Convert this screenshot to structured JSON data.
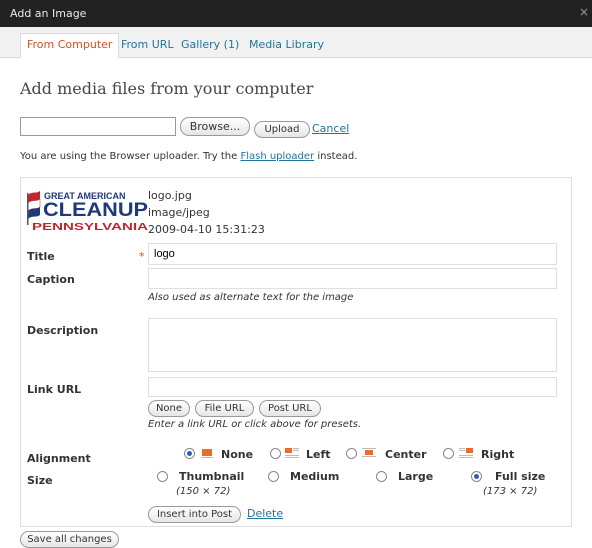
{
  "window": {
    "title": "Add an Image",
    "close_glyph": "×"
  },
  "tabs": [
    {
      "label": "From Computer",
      "active": true
    },
    {
      "label": "From URL",
      "active": false
    },
    {
      "label": "Gallery (1)",
      "active": false
    },
    {
      "label": "Media Library",
      "active": false
    }
  ],
  "heading": "Add media files from your computer",
  "upload": {
    "file_value": "",
    "browse_label": "Browse...",
    "upload_label": "Upload",
    "cancel_label": "Cancel",
    "note_prefix": "You are using the Browser uploader. Try the ",
    "note_link": "Flash uploader",
    "note_suffix": " instead."
  },
  "logo": {
    "line1": "GREAT AMERICAN",
    "line2": "CLEANUP",
    "line3": "PENNSYLVANIA"
  },
  "file": {
    "name": "logo.jpg",
    "type": "image/jpeg",
    "date": "2009-04-10 15:31:23"
  },
  "form": {
    "title_label": "Title",
    "required_mark": "*",
    "title_value": "logo",
    "caption_label": "Caption",
    "caption_value": "",
    "caption_help": "Also used as alternate text for the image",
    "description_label": "Description",
    "description_value": "",
    "link_label": "Link URL",
    "link_value": "",
    "link_buttons": [
      "None",
      "File URL",
      "Post URL"
    ],
    "link_help": "Enter a link URL or click above for presets.",
    "alignment_label": "Alignment",
    "alignment_options": [
      {
        "label": "None",
        "selected": true
      },
      {
        "label": "Left",
        "selected": false
      },
      {
        "label": "Center",
        "selected": false
      },
      {
        "label": "Right",
        "selected": false
      }
    ],
    "size_label": "Size",
    "size_options": [
      {
        "label": "Thumbnail",
        "dims": "(150 × 72)",
        "selected": false
      },
      {
        "label": "Medium",
        "dims": "",
        "selected": false
      },
      {
        "label": "Large",
        "dims": "",
        "selected": false
      },
      {
        "label": "Full size",
        "dims": "(173 × 72)",
        "selected": true
      }
    ],
    "insert_label": "Insert into Post",
    "delete_label": "Delete"
  },
  "save_all_label": "Save all changes",
  "colors": {
    "titlebar": "#222222",
    "link": "#21759b",
    "active_tab": "#d54e21",
    "radio_on": "#2a5fb8"
  }
}
